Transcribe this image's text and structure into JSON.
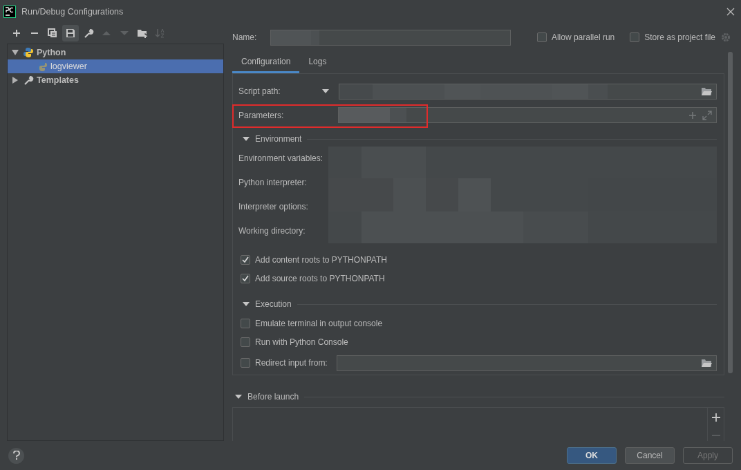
{
  "window": {
    "title": "Run/Debug Configurations"
  },
  "toolbar": [
    {
      "kind": "add",
      "disabled": false,
      "selected": false
    },
    {
      "kind": "remove",
      "disabled": false,
      "selected": false
    },
    {
      "kind": "copy",
      "disabled": false,
      "selected": false
    },
    {
      "kind": "save",
      "disabled": false,
      "selected": true
    },
    {
      "kind": "wrench",
      "disabled": false,
      "selected": false
    },
    {
      "kind": "up",
      "disabled": true,
      "selected": false
    },
    {
      "kind": "down",
      "disabled": true,
      "selected": false
    },
    {
      "kind": "folder",
      "disabled": false,
      "selected": false
    },
    {
      "kind": "sort",
      "disabled": true,
      "selected": false
    }
  ],
  "tree": [
    {
      "label": "Python",
      "expanded": true,
      "selected": false,
      "children": [
        {
          "label": "logviewer",
          "selected": true
        }
      ]
    },
    {
      "label": "Templates",
      "expanded": false,
      "selected": false
    }
  ],
  "name_row": {
    "label": "Name:",
    "redacted": true,
    "options": [
      {
        "label": "Allow parallel run",
        "checked": false
      },
      {
        "label": "Store as project file",
        "checked": false
      }
    ]
  },
  "tabs": [
    {
      "label": "Configuration",
      "selected": true
    },
    {
      "label": "Logs",
      "selected": false
    }
  ],
  "fields": [
    {
      "label": "Script path:",
      "kind": "dropdown",
      "redacted": true,
      "highlighted": false
    },
    {
      "label": "Parameters:",
      "kind": "expandable",
      "redacted": true,
      "highlighted": true
    }
  ],
  "environment": {
    "title": "Environment",
    "expanded": true,
    "rows": [
      "Environment variables:",
      "Python interpreter:",
      "Interpreter options:",
      "Working directory:"
    ],
    "redacted": true,
    "options": [
      {
        "label": "Add content roots to PYTHONPATH",
        "checked": true
      },
      {
        "label": "Add source roots to PYTHONPATH",
        "checked": true
      }
    ]
  },
  "execution": {
    "title": "Execution",
    "expanded": true,
    "options": [
      {
        "label": "Emulate terminal in output console",
        "checked": false,
        "kind": "checkbox"
      },
      {
        "label": "Run with Python Console",
        "checked": false,
        "kind": "checkbox"
      },
      {
        "label": "Redirect input from:",
        "checked": false,
        "kind": "file"
      }
    ]
  },
  "before_launch": {
    "title": "Before launch",
    "expanded": true
  },
  "buttons": [
    {
      "label": "OK",
      "kind": "primary"
    },
    {
      "label": "Cancel",
      "kind": "default"
    },
    {
      "label": "Apply",
      "kind": "disabled"
    }
  ]
}
